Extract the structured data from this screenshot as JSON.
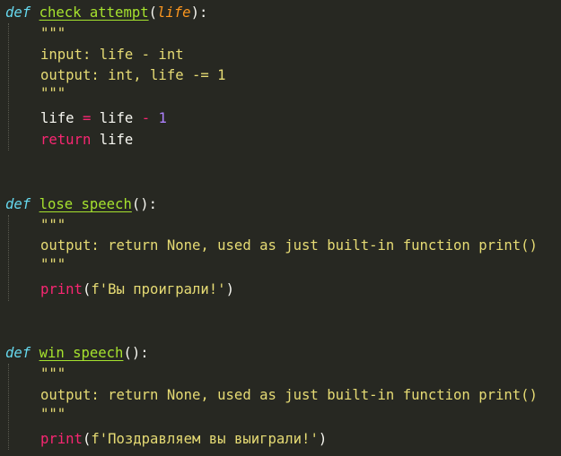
{
  "code": {
    "functions": [
      {
        "def_keyword": "def",
        "name": "check_attempt",
        "params": "life",
        "docstring_open": "\"\"\"",
        "doc_lines": [
          "input: life - int",
          "output: int, life -= 1"
        ],
        "docstring_close": "\"\"\"",
        "body": {
          "assign_target": "life",
          "assign_op": "=",
          "assign_left": "life",
          "minus": "-",
          "number": "1",
          "return_keyword": "return",
          "return_value": "life"
        }
      },
      {
        "def_keyword": "def",
        "name": "lose_speech",
        "params": "",
        "docstring_open": "\"\"\"",
        "doc_lines": [
          "output: return None, used as just built-in function print()"
        ],
        "docstring_close": "\"\"\"",
        "body": {
          "call": "print",
          "string": "f'Вы проиграли!'"
        }
      },
      {
        "def_keyword": "def",
        "name": "win_speech",
        "params": "",
        "docstring_open": "\"\"\"",
        "doc_lines": [
          "output: return None, used as just built-in function print()"
        ],
        "docstring_close": "\"\"\"",
        "body": {
          "call": "print",
          "string": "f'Поздравляем вы выиграли!'"
        }
      }
    ],
    "colors": {
      "background": "#272822",
      "keyword_def": "#66d9ef",
      "function_name": "#a6e22e",
      "parameter": "#fd971f",
      "docstring": "#e6db74",
      "keyword": "#f92672",
      "number": "#ae81ff"
    }
  }
}
